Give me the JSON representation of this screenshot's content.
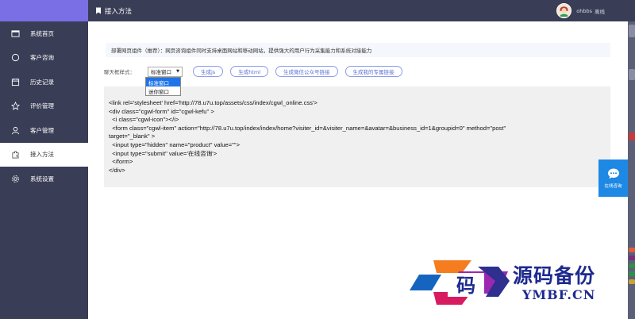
{
  "colors": {
    "sidebar_bg": "#3a3d56",
    "brand_bg": "#7b6fe6",
    "accent": "#5b6fd6",
    "online_button": "#1e88e5",
    "watermark": "#1d2a8f"
  },
  "header": {
    "title": "接入方法",
    "title_icon": "bookmark-icon",
    "user_name": "ohbbs",
    "user_status": "离线"
  },
  "sidebar": {
    "items": [
      {
        "label": "系统首页",
        "icon": "monitor-icon",
        "active": false
      },
      {
        "label": "客户咨询",
        "icon": "circle-icon",
        "active": false
      },
      {
        "label": "历史记录",
        "icon": "calendar-icon",
        "active": false
      },
      {
        "label": "评价管理",
        "icon": "star-icon",
        "active": false
      },
      {
        "label": "客户管理",
        "icon": "user-icon",
        "active": false
      },
      {
        "label": "接入方法",
        "icon": "puzzle-icon",
        "active": true
      },
      {
        "label": "系统设置",
        "icon": "gear-icon",
        "active": false
      }
    ]
  },
  "notice": "部署网页组件（推荐）：网页咨询组件同时支持桌面网站和移动网站，提供强大的用户行为采集能力和系统对接能力",
  "toolbar": {
    "style_label": "聊天框样式：",
    "select_value": "标准窗口",
    "options": [
      "标准窗口",
      "迷你窗口"
    ],
    "buttons": [
      "生成js",
      "生成html",
      "生成微信公众号链接",
      "生成我的专属链接"
    ]
  },
  "code_lines": [
    "<link rel='stylesheet' href='http://78.u7u.top/assets/css/index/cgwl_online.css'>",
    "<div class=\"cgwl-form\" id=\"cgwl-kefu\" >",
    "  <i class=\"cgwl-icon\"></i>",
    "  <form class=\"cgwl-item\" action=\"http://78.u7u.top/index/index/home?visiter_id=&visiter_name=&avatar=&business_id=1&groupid=0\" method=\"post\"",
    "target=\"_blank\" >",
    "  <input type=\"hidden\" name=\"product\" value=\"\">",
    "  <input type=\"submit\" value='在线咨询'>",
    "  </form>",
    "</div>"
  ],
  "online_button": {
    "label": "在线咨询",
    "icon": "chat-icon"
  },
  "watermark": {
    "logo_char": "码",
    "cn": "源码备份",
    "en": "YMBF.CN"
  }
}
